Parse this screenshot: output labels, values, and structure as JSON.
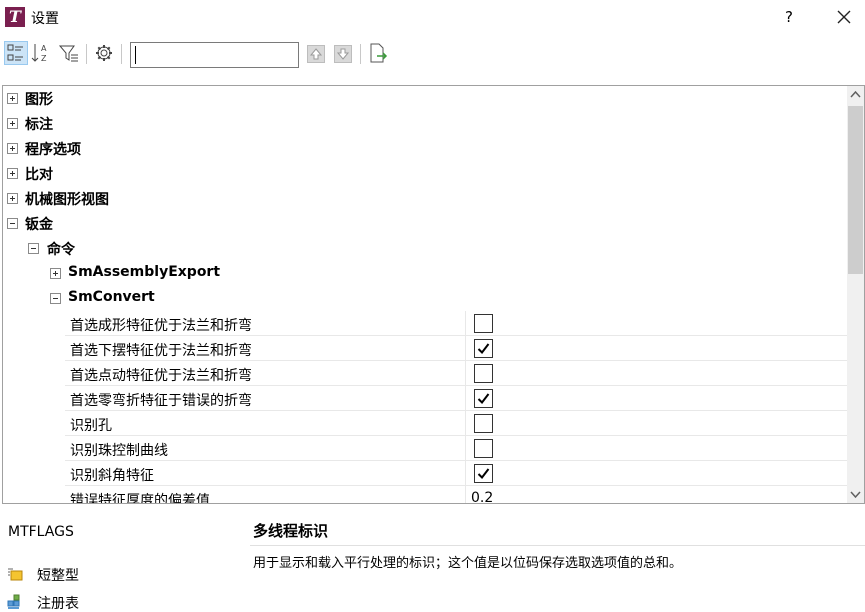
{
  "window": {
    "title": "设置",
    "help": "?"
  },
  "toolbar": {
    "buttons": [
      "categorized-view",
      "alphabetical-view",
      "filter",
      "settings",
      "move-up",
      "move-down",
      "export"
    ],
    "search_value": ""
  },
  "tree": [
    {
      "label": "图形",
      "state": "collapsed"
    },
    {
      "label": "标注",
      "state": "collapsed"
    },
    {
      "label": "程序选项",
      "state": "collapsed"
    },
    {
      "label": "比对",
      "state": "collapsed"
    },
    {
      "label": "机械图形视图",
      "state": "collapsed"
    },
    {
      "label": "钣金",
      "state": "expanded"
    },
    {
      "label": "命令",
      "state": "expanded"
    },
    {
      "label": "SmAssemblyExport",
      "state": "collapsed"
    },
    {
      "label": "SmConvert",
      "state": "expanded"
    }
  ],
  "properties": [
    {
      "name": "首选成形特征优于法兰和折弯",
      "checked": false
    },
    {
      "name": "首选下摆特征优于法兰和折弯",
      "checked": true
    },
    {
      "name": "首选点动特征优于法兰和折弯",
      "checked": false
    },
    {
      "name": "首选零弯折特征于错误的折弯",
      "checked": true
    },
    {
      "name": "识别孔",
      "checked": false
    },
    {
      "name": "识别珠控制曲线",
      "checked": false
    },
    {
      "name": "识别斜角特征",
      "checked": true
    },
    {
      "name": "错误特征厚度的偏差值",
      "value": "0.2"
    }
  ],
  "info": {
    "name": "MTFLAGS",
    "title": "多线程标识",
    "description": "用于显示和载入平行处理的标识；这个值是以位码保存选取选项值的总和。",
    "types": [
      {
        "label": "短整型",
        "icon": "short-integer-icon"
      },
      {
        "label": "注册表",
        "icon": "registry-icon"
      }
    ]
  },
  "colors": {
    "accent": "#7a1f4f",
    "selected_button": "#cce4f7",
    "arrow_green": "#3a9a3a"
  }
}
